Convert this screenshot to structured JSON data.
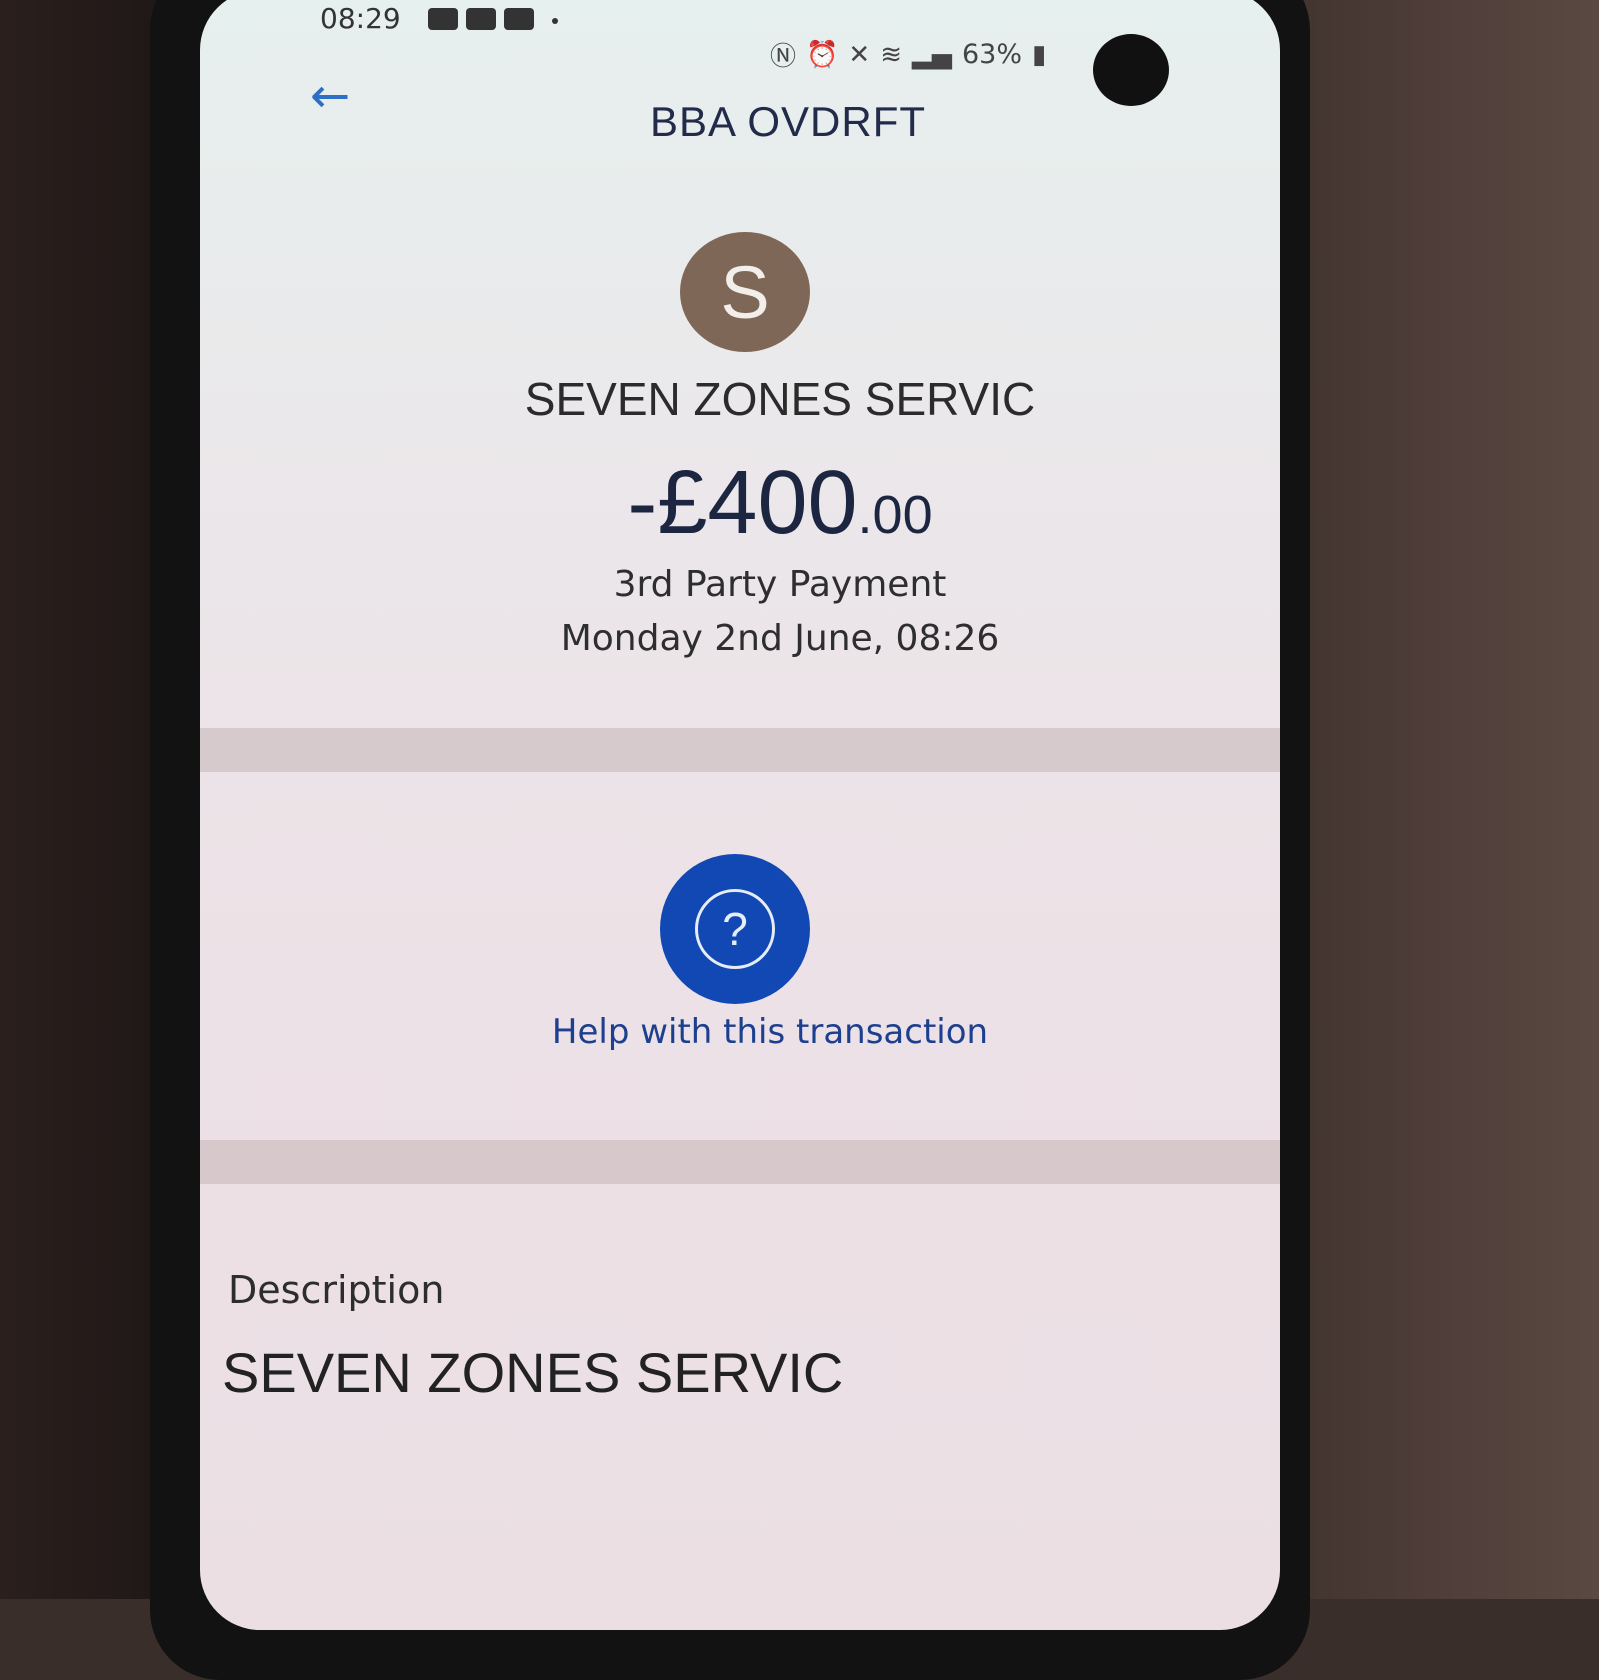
{
  "status_bar": {
    "time": "08:29",
    "battery": "63%",
    "icons_left": [
      "mail-icon",
      "youtube-icon",
      "youtube-icon"
    ],
    "icons_right": [
      "nfc-icon",
      "alarm-icon",
      "mute-icon",
      "wifi-icon",
      "signal-icon",
      "battery-icon"
    ]
  },
  "header": {
    "back_icon": "arrow-left-icon",
    "title": "BBA OVDRFT"
  },
  "merchant": {
    "initial": "S",
    "name": "SEVEN ZONES SERVIC",
    "avatar_color": "#7f6757"
  },
  "transaction": {
    "amount_main": "-£400",
    "amount_pence": ".00",
    "type": "3rd Party Payment",
    "date": "Monday 2nd June, 08:26"
  },
  "help": {
    "icon": "question-icon",
    "label": "Help with this transaction",
    "color": "#1148b3"
  },
  "description": {
    "label": "Description",
    "value": "SEVEN ZONES SERVIC"
  }
}
